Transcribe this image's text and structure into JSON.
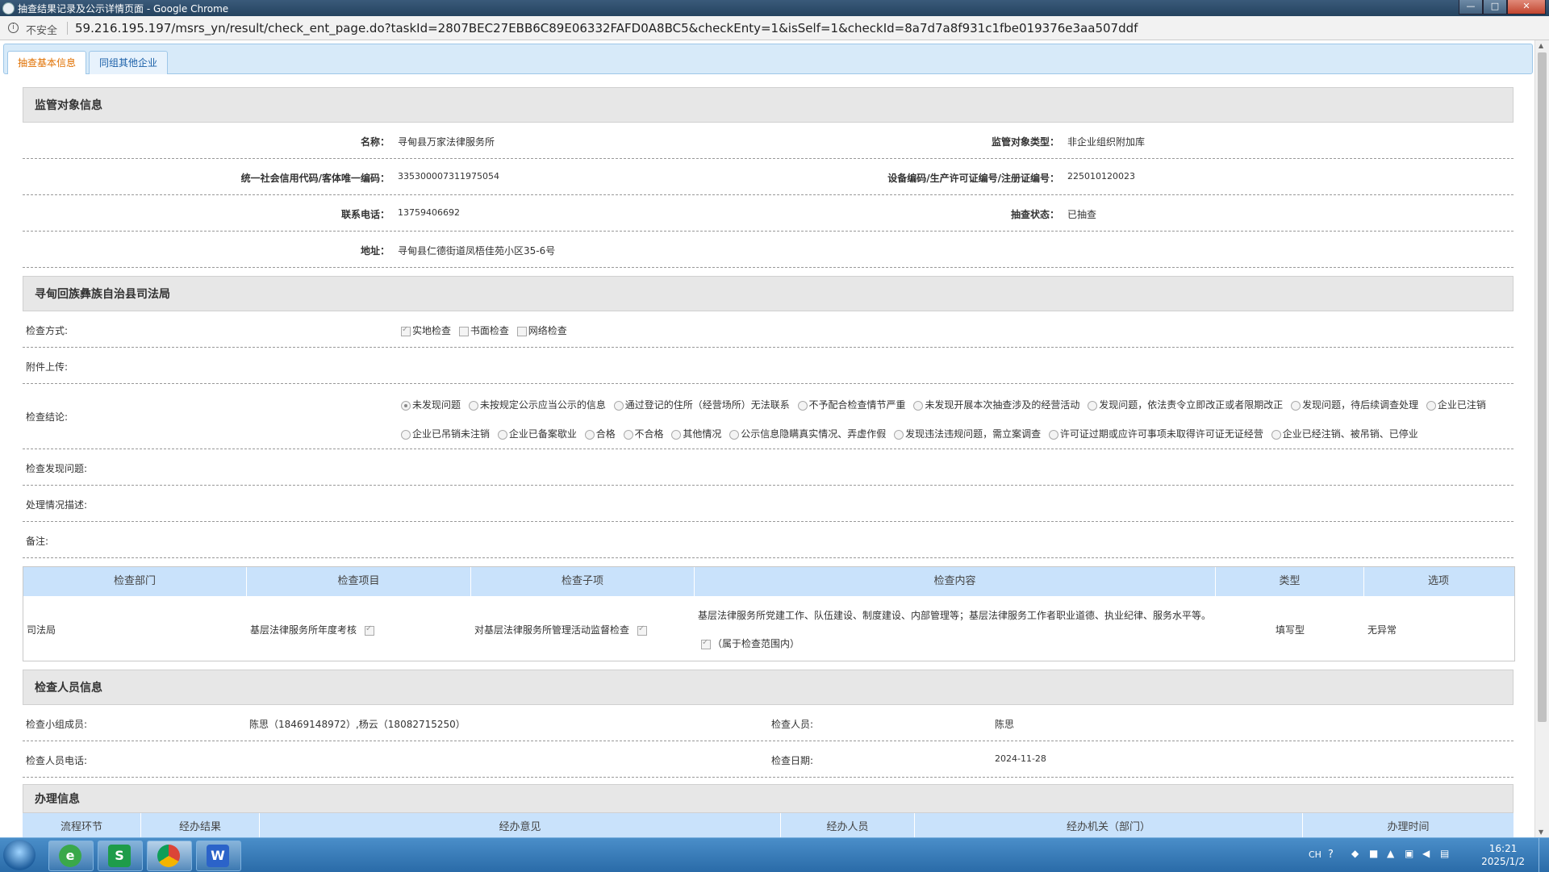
{
  "window": {
    "title": "抽查结果记录及公示详情页面 - Google Chrome",
    "controls": [
      "—",
      "□",
      "✕"
    ]
  },
  "address": {
    "security": "不安全",
    "url": "59.216.195.197/msrs_yn/result/check_ent_page.do?taskId=2807BEC27EBB6C89E06332FAFD0A8BC5&checkEnty=1&isSelf=1&checkId=8a7d7a8f931c1fbe019376e3aa507ddf"
  },
  "tabs": [
    {
      "label": "抽查基本信息",
      "active": true
    },
    {
      "label": "同组其他企业",
      "active": false
    }
  ],
  "subject": {
    "title": "监管对象信息",
    "name_label": "名称：",
    "name": "寻甸县万家法律服务所",
    "type_label": "监管对象类型：",
    "type": "非企业组织附加库",
    "credit_label": "统一社会信用代码/客体唯一编码：",
    "credit": "335300007311975054",
    "license_label": "设备编码/生产许可证编号/注册证编号：",
    "license": "225010120023",
    "phone_label": "联系电话：",
    "phone": "13759406692",
    "status_label": "抽查状态：",
    "status": "已抽查",
    "address_label": "地址：",
    "address": "寻甸县仁德街道凤梧佳苑小区35-6号"
  },
  "bureau": {
    "title": "寻甸回族彝族自治县司法局",
    "method_label": "检查方式:",
    "methods": [
      {
        "label": "实地检查",
        "checked": true
      },
      {
        "label": "书面检查",
        "checked": false
      },
      {
        "label": "网络检查",
        "checked": false
      }
    ],
    "attachment_label": "附件上传:",
    "conclusion_label": "检查结论:",
    "conclusions": [
      {
        "label": "未发现问题",
        "checked": true
      },
      {
        "label": "未按规定公示应当公示的信息",
        "checked": false
      },
      {
        "label": "通过登记的住所（经营场所）无法联系",
        "checked": false
      },
      {
        "label": "不予配合检查情节严重",
        "checked": false
      },
      {
        "label": "未发现开展本次抽查涉及的经营活动",
        "checked": false
      },
      {
        "label": "发现问题，依法责令立即改正或者限期改正",
        "checked": false
      },
      {
        "label": "发现问题，待后续调查处理",
        "checked": false
      },
      {
        "label": "企业已注销",
        "checked": false
      },
      {
        "label": "企业已吊销未注销",
        "checked": false
      },
      {
        "label": "企业已备案歇业",
        "checked": false
      },
      {
        "label": "合格",
        "checked": false
      },
      {
        "label": "不合格",
        "checked": false
      },
      {
        "label": "其他情况",
        "checked": false
      },
      {
        "label": "公示信息隐瞒真实情况、弄虚作假",
        "checked": false
      },
      {
        "label": "发现违法违规问题，需立案调查",
        "checked": false
      },
      {
        "label": "许可证过期或应许可事项未取得许可证无证经营",
        "checked": false
      },
      {
        "label": "企业已经注销、被吊销、已停业",
        "checked": false
      }
    ],
    "issues_label": "检查发现问题:",
    "handling_label": "处理情况描述:",
    "remarks_label": "备注:"
  },
  "check_table": {
    "headers": [
      "检查部门",
      "检查项目",
      "检查子项",
      "检查内容",
      "类型",
      "选项"
    ],
    "row": {
      "dept": "司法局",
      "item": "基层法律服务所年度考核",
      "subitem": "对基层法律服务所管理活动监督检查",
      "content": "基层法律服务所党建工作、队伍建设、制度建设、内部管理等；基层法律服务工作者职业道德、执业纪律、服务水平等。",
      "scope": "（属于检查范围内）",
      "type": "填写型",
      "option": "无异常"
    }
  },
  "inspectors": {
    "title": "检查人员信息",
    "members_label": "检查小组成员:",
    "members": "陈思（18469148972）,杨云（18082715250）",
    "inspector_label": "检查人员:",
    "inspector": "陈思",
    "phone_label": "检查人员电话:",
    "phone": "",
    "date_label": "检查日期:",
    "date": "2024-11-28"
  },
  "handling": {
    "title": "办理信息",
    "headers": [
      "流程环节",
      "经办结果",
      "经办意见",
      "经办人员",
      "经办机关（部门）",
      "办理时间"
    ]
  },
  "taskbar": {
    "apps": [
      "e",
      "S",
      "",
      "W"
    ],
    "tray_lang": "CH",
    "time": "16:21",
    "date": "2025/1/2"
  },
  "colors": {
    "tab_active_text": "#e07000",
    "table_header_bg": "#c9e2fb",
    "section_bg": "#e7e7e7"
  }
}
